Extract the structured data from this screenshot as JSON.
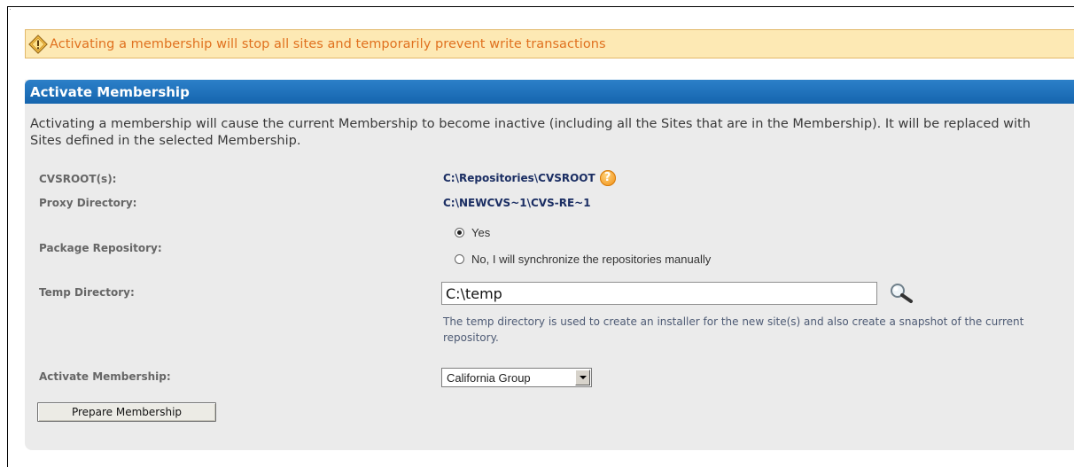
{
  "warning": {
    "icon": "warning-diamond-icon",
    "text": "Activating a membership will stop all sites and temporarily prevent write transactions"
  },
  "panel": {
    "title": "Activate Membership",
    "description": "Activating a membership will cause the current Membership to become inactive (including all the Sites that are in the Membership). It will be replaced with Sites defined in the selected Membership.",
    "cvsroot": {
      "label": "CVSROOT(s):",
      "value": "C:\\Repositories\\CVSROOT",
      "help_icon": "?"
    },
    "proxy": {
      "label": "Proxy Directory:",
      "value": "C:\\NEWCVS~1\\CVS-RE~1"
    },
    "package": {
      "label": "Package Repository:",
      "options": [
        {
          "label": "Yes",
          "selected": true
        },
        {
          "label": "No, I will synchronize the repositories manually",
          "selected": false
        }
      ]
    },
    "temp": {
      "label": "Temp Directory:",
      "value": "C:\\temp",
      "help": "The temp directory is used to create an installer for the new site(s) and also create a snapshot of the current repository."
    },
    "activate": {
      "label": "Activate Membership:",
      "selected": "California Group"
    },
    "prepare_button": "Prepare Membership"
  },
  "colors": {
    "warning_bg": "#fde9b4",
    "warning_text": "#e0711f",
    "header_blue": "#1c6fb8",
    "panel_bg": "#ebebeb"
  }
}
